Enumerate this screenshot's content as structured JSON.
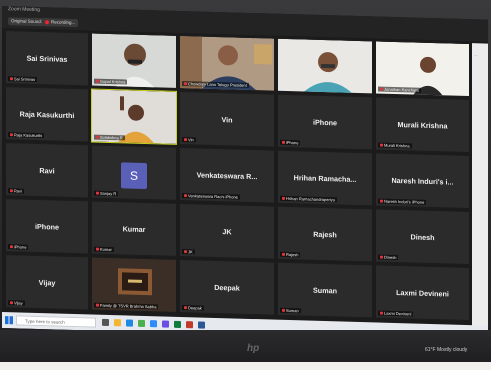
{
  "window": {
    "title": "Zoom Meeting"
  },
  "toolbar": {
    "original_sound": "Original Sound: Off",
    "recording": "Recording..."
  },
  "tiles": [
    {
      "name": "Sai Srinivas",
      "label": "Sai Srinivas"
    },
    {
      "name": "",
      "label": "Gopal Krishna"
    },
    {
      "name": "",
      "label": "Chowdary Lanu Telugu President"
    },
    {
      "name": "",
      "label": ""
    },
    {
      "name": "",
      "label": "Jonathan Kanchara"
    },
    {
      "name": "Raja Kasukurthi",
      "label": "Raja Kasukurthi"
    },
    {
      "name": "",
      "label": "Sulakshna R"
    },
    {
      "name": "Vin",
      "label": "Vin"
    },
    {
      "name": "iPhone",
      "label": "iPhone"
    },
    {
      "name": "Murali Krishna",
      "label": "Murali Krishna"
    },
    {
      "name": "Ravi",
      "label": "Ravi"
    },
    {
      "name": "",
      "label": "Sanjay R"
    },
    {
      "name": "Venkateswara R...",
      "label": "Venkateswara Rao's iPhone"
    },
    {
      "name": "Hrihan Ramacha...",
      "label": "Hrihan Ramachandraperiyu"
    },
    {
      "name": "Naresh Induri's i...",
      "label": "Naresh Induri's iPhone"
    },
    {
      "name": "iPhone",
      "label": "iPhone"
    },
    {
      "name": "Kumar",
      "label": "Kumar"
    },
    {
      "name": "JK",
      "label": "JK"
    },
    {
      "name": "Rajesh",
      "label": "Rajesh"
    },
    {
      "name": "Dinesh",
      "label": "Dinesh"
    },
    {
      "name": "Vijay",
      "label": "Vijay"
    },
    {
      "name": "",
      "label": "Family @ TSVR Brahma Sabha"
    },
    {
      "name": "Deepak",
      "label": "Deepak"
    },
    {
      "name": "Suman",
      "label": "Suman"
    },
    {
      "name": "Laxmi Devineni",
      "label": "Laxmi Devineni"
    }
  ],
  "avatar_letter": "S",
  "taskbar": {
    "search_placeholder": "Type here to search",
    "weather": "61°F Mostly cloudy"
  },
  "brand": {
    "logo": "hp"
  },
  "colors": {
    "active_speaker_border": "#c8d21c",
    "avatar_bg": "#5a5fb8",
    "mute_red": "#e5343a"
  }
}
